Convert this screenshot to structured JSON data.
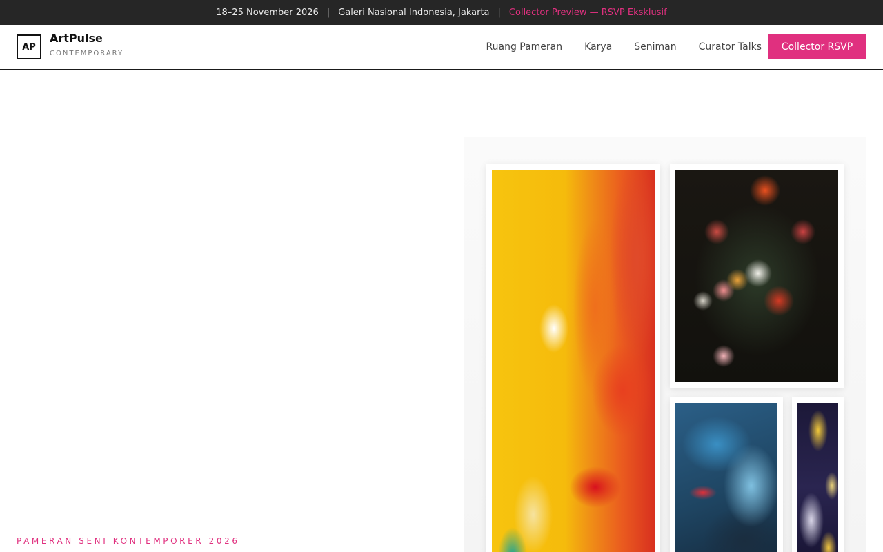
{
  "announcement": {
    "dates": "18–25 November 2026",
    "separator": "|",
    "venue": "Galeri Nasional Indonesia, Jakarta",
    "promo": "Collector Preview — RSVP Eksklusif"
  },
  "brand": {
    "logo_mark": "AP",
    "name": "ArtPulse",
    "tagline": "CONTEMPORARY"
  },
  "nav": {
    "items": [
      {
        "label": "Ruang Pameran"
      },
      {
        "label": "Karya"
      },
      {
        "label": "Seniman"
      },
      {
        "label": "Curator Talks"
      }
    ],
    "cta_label": "Collector RSVP"
  },
  "hero": {
    "eyebrow": "PAMERAN SENI KONTEMPORER 2026"
  },
  "colors": {
    "accent": "#e0307f",
    "topbar_bg": "#262626"
  }
}
